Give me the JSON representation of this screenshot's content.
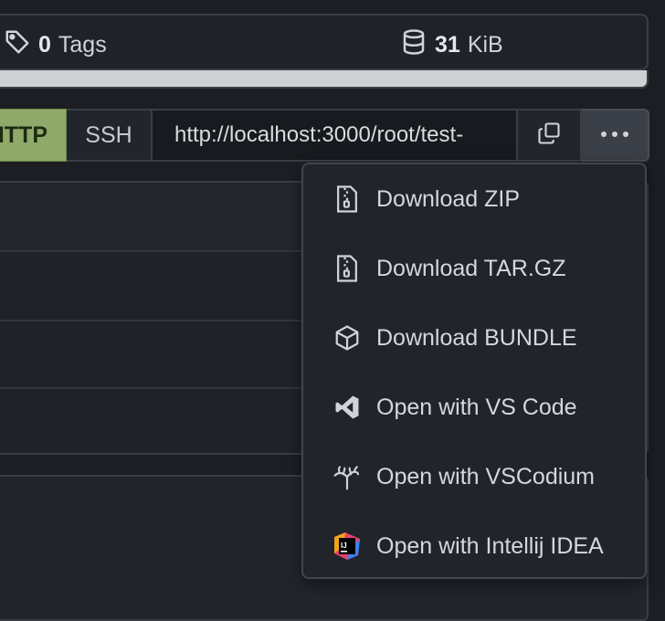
{
  "stats": {
    "tags_count": "0",
    "tags_label": "Tags",
    "size_value": "31",
    "size_unit": "KiB"
  },
  "clone": {
    "http_label": "HTTP",
    "ssh_label": "SSH",
    "url": "http://localhost:3000/root/test-"
  },
  "menu": {
    "items": [
      {
        "label": "Download ZIP",
        "icon": "file-zip-icon"
      },
      {
        "label": "Download TAR.GZ",
        "icon": "file-zip-icon"
      },
      {
        "label": "Download BUNDLE",
        "icon": "package-icon"
      },
      {
        "label": "Open with VS Code",
        "icon": "vscode-icon"
      },
      {
        "label": "Open with VSCodium",
        "icon": "vscodium-icon"
      },
      {
        "label": "Open with Intellij IDEA",
        "icon": "intellij-icon"
      }
    ]
  },
  "colors": {
    "http_active": "#8fa96a",
    "menu_bg": "#21242b",
    "page_bg": "#1c1e24"
  }
}
